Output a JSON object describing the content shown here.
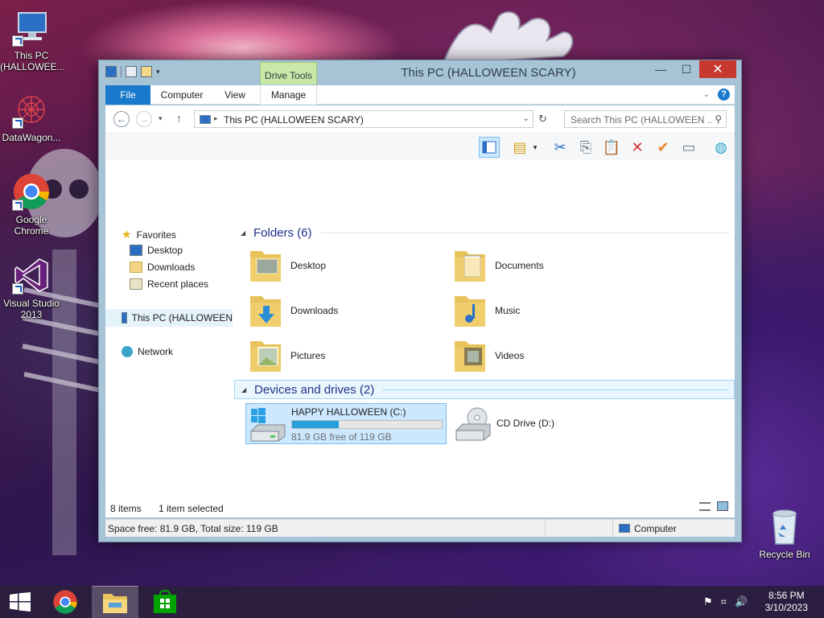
{
  "desktop": {
    "icons": [
      {
        "label": "This PC\n(HALLOWEE..."
      },
      {
        "label": "DataWagon..."
      },
      {
        "label": "Google\nChrome"
      },
      {
        "label": "Visual Studio\n2013"
      }
    ],
    "recycle_bin": "Recycle Bin"
  },
  "window": {
    "title": "This PC (HALLOWEEN SCARY)",
    "contextual_tab": "Drive Tools",
    "tabs": [
      "File",
      "Computer",
      "View",
      "Manage"
    ],
    "address": "This PC (HALLOWEEN SCARY)",
    "search_placeholder": "Search This PC (HALLOWEEN ...",
    "nav": {
      "favorites": "Favorites",
      "fav_items": [
        "Desktop",
        "Downloads",
        "Recent places"
      ],
      "this_pc": "This PC (HALLOWEEN",
      "network": "Network"
    },
    "folders_header": "Folders (6)",
    "folders": [
      "Desktop",
      "Documents",
      "Downloads",
      "Music",
      "Pictures",
      "Videos"
    ],
    "devices_header": "Devices and drives (2)",
    "drive_c": {
      "name": "HAPPY HALLOWEEN (C:)",
      "free": "81.9 GB free of 119 GB",
      "used_fraction": 0.312
    },
    "drive_d": {
      "name": "CD Drive (D:)"
    },
    "status": {
      "items": "8 items",
      "selected": "1 item selected"
    },
    "details": {
      "space": "Space free: 81.9 GB, Total size: 119 GB",
      "location": "Computer"
    }
  },
  "taskbar": {
    "time": "8:56 PM",
    "date": "3/10/2023"
  }
}
